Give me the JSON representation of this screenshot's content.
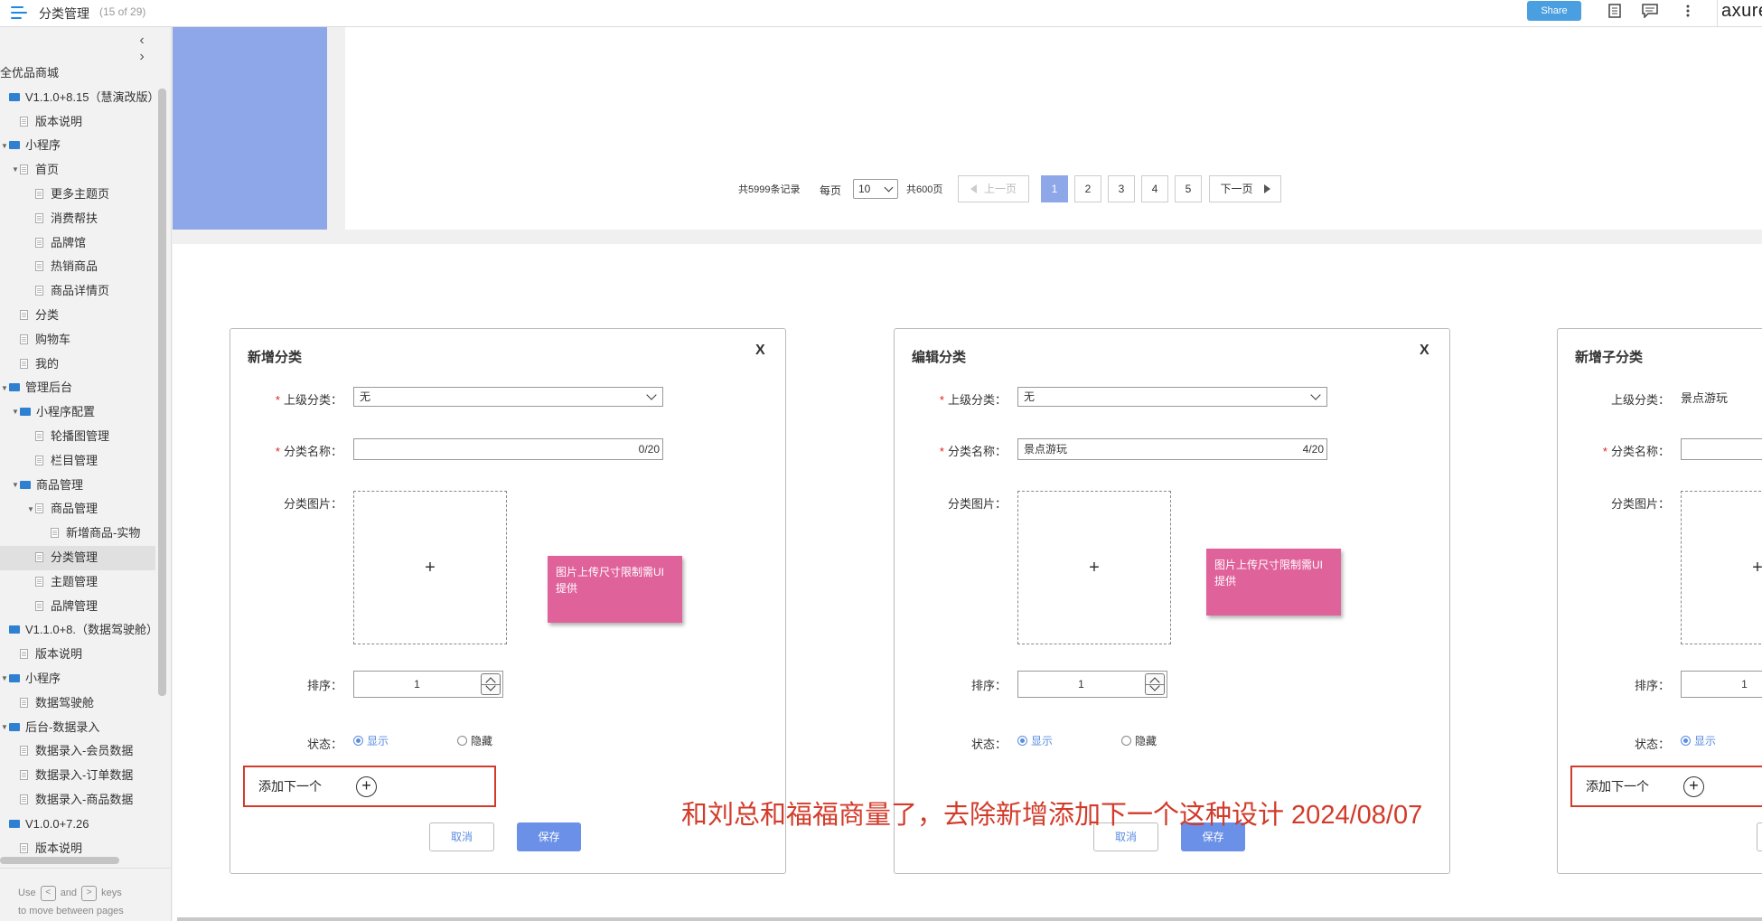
{
  "header": {
    "title": "分类管理",
    "page_count": "(15 of 29)",
    "share_label": "Share",
    "logo": "axure"
  },
  "sidebar": {
    "items": [
      {
        "label": "全优品商城",
        "type": "text",
        "depth": 0
      },
      {
        "label": "V1.1.0+8.15（慧演改版）",
        "type": "folder",
        "depth": 0
      },
      {
        "label": "版本说明",
        "type": "page",
        "depth": 1
      },
      {
        "label": "小程序",
        "type": "folder",
        "depth": 0,
        "expanded": true
      },
      {
        "label": "首页",
        "type": "page",
        "depth": 1,
        "expanded": true
      },
      {
        "label": "更多主题页",
        "type": "page",
        "depth": 2
      },
      {
        "label": "消费帮扶",
        "type": "page",
        "depth": 2
      },
      {
        "label": "品牌馆",
        "type": "page",
        "depth": 2
      },
      {
        "label": "热销商品",
        "type": "page",
        "depth": 2
      },
      {
        "label": "商品详情页",
        "type": "page",
        "depth": 2
      },
      {
        "label": "分类",
        "type": "page",
        "depth": 1
      },
      {
        "label": "购物车",
        "type": "page",
        "depth": 1
      },
      {
        "label": "我的",
        "type": "page",
        "depth": 1
      },
      {
        "label": "管理后台",
        "type": "folder",
        "depth": 0,
        "expanded": true
      },
      {
        "label": "小程序配置",
        "type": "folder",
        "depth": 1,
        "expanded": true
      },
      {
        "label": "轮播图管理",
        "type": "page",
        "depth": 2
      },
      {
        "label": "栏目管理",
        "type": "page",
        "depth": 2
      },
      {
        "label": "商品管理",
        "type": "folder",
        "depth": 1,
        "expanded": true
      },
      {
        "label": "商品管理",
        "type": "page",
        "depth": 2,
        "expanded": true
      },
      {
        "label": "新增商品-实物",
        "type": "page",
        "depth": 3
      },
      {
        "label": "分类管理",
        "type": "page",
        "depth": 2,
        "selected": true
      },
      {
        "label": "主题管理",
        "type": "page",
        "depth": 2
      },
      {
        "label": "品牌管理",
        "type": "page",
        "depth": 2
      },
      {
        "label": "V1.1.0+8.（数据驾驶舱）",
        "type": "folder",
        "depth": 0
      },
      {
        "label": "版本说明",
        "type": "page",
        "depth": 1
      },
      {
        "label": "小程序",
        "type": "folder",
        "depth": 0,
        "expanded": true
      },
      {
        "label": "数据驾驶舱",
        "type": "page",
        "depth": 1
      },
      {
        "label": "后台-数据录入",
        "type": "folder",
        "depth": 0,
        "expanded": true
      },
      {
        "label": "数据录入-会员数据",
        "type": "page",
        "depth": 1
      },
      {
        "label": "数据录入-订单数据",
        "type": "page",
        "depth": 1
      },
      {
        "label": "数据录入-商品数据",
        "type": "page",
        "depth": 1
      },
      {
        "label": "V1.0.0+7.26",
        "type": "folder",
        "depth": 0
      },
      {
        "label": "版本说明",
        "type": "page",
        "depth": 1
      }
    ],
    "hint": {
      "use": "Use",
      "and": "and",
      "keys": "keys",
      "line2": "to move between pages",
      "prev_key": "<",
      "next_key": ">"
    },
    "nav_prev": "‹",
    "nav_next": "›"
  },
  "pager": {
    "total_records": "共5999条记录",
    "per_page_label": "每页",
    "per_page_value": "10",
    "total_pages": "共600页",
    "prev_label": "上一页",
    "next_label": "下一页",
    "pages": [
      "1",
      "2",
      "3",
      "4",
      "5"
    ],
    "current_page": 1
  },
  "dialogs": [
    {
      "title": "新增分类",
      "close": "X",
      "parent_label": "上级分类：",
      "parent_value": "无",
      "name_label": "分类名称：",
      "name_value": "",
      "name_count": "0/20",
      "image_label": "分类图片：",
      "upload_plus": "+",
      "sticky_note": "图片上传尺寸限制需UI提供",
      "sort_label": "排序：",
      "sort_value": "1",
      "status_label": "状态：",
      "status_show": "显示",
      "status_hide": "隐藏",
      "add_next_label": "添加下一个",
      "cancel_label": "取消",
      "save_label": "保存"
    },
    {
      "title": "编辑分类",
      "close": "X",
      "parent_label": "上级分类：",
      "parent_value": "无",
      "name_label": "分类名称：",
      "name_value": "景点游玩",
      "name_count": "4/20",
      "image_label": "分类图片：",
      "upload_plus": "+",
      "sticky_note": "图片上传尺寸限制需UI提供",
      "sort_label": "排序：",
      "sort_value": "1",
      "status_label": "状态：",
      "status_show": "显示",
      "status_hide": "隐藏",
      "cancel_label": "取消",
      "save_label": "保存"
    },
    {
      "title": "新增子分类",
      "parent_label": "上级分类：",
      "parent_value": "景点游玩",
      "name_label": "分类名称：",
      "image_label": "分类图片：",
      "upload_plus": "+",
      "sort_label": "排序：",
      "sort_value": "1",
      "status_label": "状态：",
      "status_show": "显示",
      "add_next_label": "添加下一个"
    }
  ],
  "annotation": "和刘总和福福商量了，去除新增添加下一个这种设计  2024/08/07",
  "colors": {
    "accent_blue": "#1e88e5",
    "share_blue": "#4a9fe0",
    "block_blue": "#8ea7e8",
    "save_blue": "#6b90e8",
    "sticky_pink": "#e0629b",
    "annotation_red": "#d23b2a",
    "required_red": "#e02020"
  }
}
